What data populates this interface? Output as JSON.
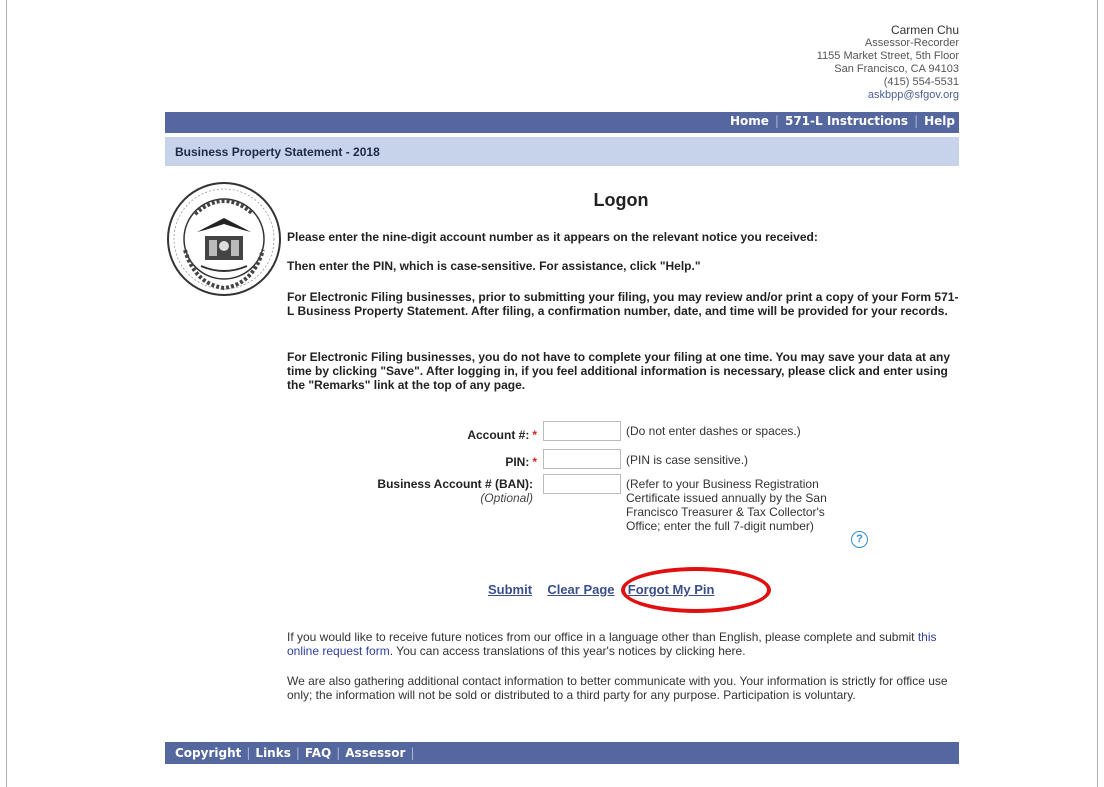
{
  "contact": {
    "name": "Carmen Chu",
    "role": "Assessor-Recorder",
    "address1": "1155 Market Street, 5th Floor",
    "address2": "San Francisco, CA 94103",
    "phone": "(415) 554-5531",
    "email": "askbpp@sfgov.org"
  },
  "topnav": {
    "home": "Home",
    "instructions": "571-L Instructions",
    "help": "Help"
  },
  "subhead": "Business Property Statement - 2018",
  "title": "Logon",
  "paragraphs": [
    "Please enter the nine-digit account number as it appears on the relevant notice you received:",
    "Then enter the PIN, which is case-sensitive. For assistance, click \"Help.\"",
    "For Electronic Filing businesses, prior to submitting your filing, you may review and/or print a copy of your Form 571-L Business Property Statement. After filing, a confirmation number, date, and time will be provided for your records.",
    "For Electronic Filing businesses, you do not have to complete your filing at one time. You may save your data at any time by clicking \"Save\". After logging in, if you feel additional information is necessary, please click and enter using the \"Remarks\" link at the top of any page."
  ],
  "form": {
    "account_label": "Account #:",
    "account_value": "",
    "account_hint": "(Do not enter dashes or spaces.)",
    "pin_label": "PIN:",
    "pin_value": "",
    "pin_hint": "(PIN is case sensitive.)",
    "ban_label": "Business Account # (BAN):",
    "ban_optional": "(Optional)",
    "ban_value": "",
    "ban_hint": "(Refer to your Business Registration Certificate issued annually by the San Francisco Treasurer & Tax Collector's Office; enter the full 7-digit number)",
    "required_mark": "*",
    "help_icon": "question-circle-icon",
    "help_glyph": "?"
  },
  "actions": {
    "submit": "Submit",
    "clear": "Clear Page",
    "forgot": "Forgot My Pin"
  },
  "notes": {
    "n1_part1": "If you would like to receive future notices from our office in a language other than English, please complete and submit ",
    "n1_link": "this online request form",
    "n1_part2": ". You can access translations of this year's notices by clicking here.",
    "n2": "We are also gathering additional contact information to better communicate with you. Your information is strictly for office use only; the information will not be sold or distributed to a third party for any purpose. Participation is voluntary."
  },
  "footer": {
    "copyright": "Copyright",
    "links": "Links",
    "faq": "FAQ",
    "assessor": "Assessor"
  },
  "colors": {
    "nav_bar": "#55679f",
    "subhead_bar": "#c7d3ea",
    "highlight_circle": "#e01010",
    "link": "#3a4f8a"
  }
}
